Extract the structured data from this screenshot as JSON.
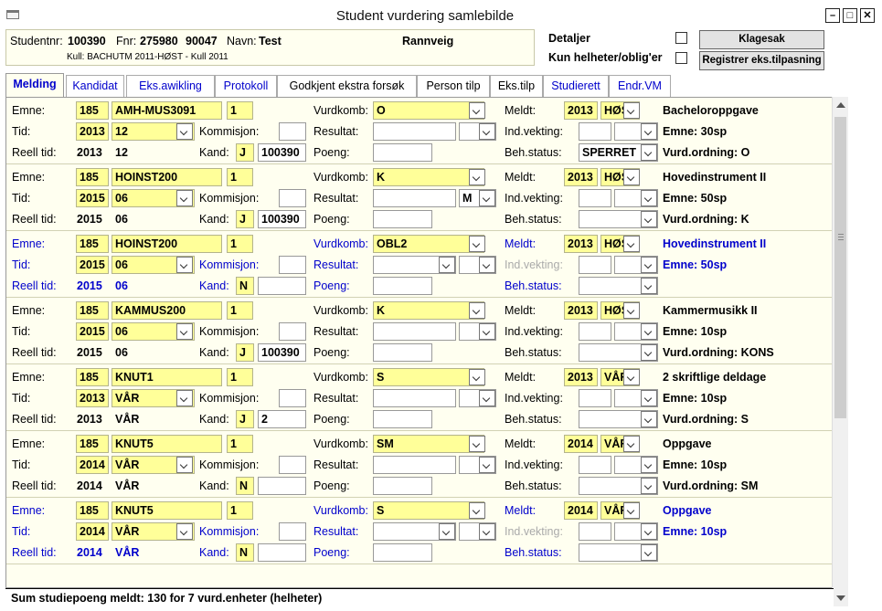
{
  "window": {
    "title": "Student vurdering samlebilde"
  },
  "header": {
    "studentnr_label": "Studentnr:",
    "studentnr": "100390",
    "fnr_label": "Fnr:",
    "fnr1": "275980",
    "fnr2": "90047",
    "navn_label": "Navn:",
    "fornavn": "Test",
    "etternavn": "Rannveig",
    "kull": "Kull: BACHUTM 2011-HØST - Kull 2011"
  },
  "options": {
    "detaljer": "Detaljer",
    "kun_helheter": "Kun helheter/oblig'er"
  },
  "buttons": {
    "klagesak": "Klagesak",
    "registrer": "Registrer eks.tilpasning"
  },
  "tabs": [
    "Melding",
    "Kandidat",
    "Eks.awikling",
    "Protokoll",
    "Godkjent ekstra forsøk",
    "Person tilp",
    "Eks.tilp",
    "Studierett",
    "Endr.VM"
  ],
  "labels": {
    "emne": "Emne:",
    "tid": "Tid:",
    "reell_tid": "Reell tid:",
    "kommisjon": "Kommisjon:",
    "kand": "Kand:",
    "vurdkomb": "Vurdkomb:",
    "resultat": "Resultat:",
    "poeng": "Poeng:",
    "meldt": "Meldt:",
    "ind_vekting": "Ind.vekting:",
    "beh_status": "Beh.status:"
  },
  "rows": [
    {
      "inst": "185",
      "emne": "AMH-MUS3091",
      "versjon": "1",
      "tid_aar": "2013",
      "tid_term": "12",
      "reell_aar": "2013",
      "reell_term": "12",
      "kand_flag": "J",
      "kand_nr": "100390",
      "vurdkomb": "O",
      "resultat_grade": "",
      "meldt_aar": "2013",
      "meldt_term": "HØST",
      "beh_status": "SPERRET",
      "emne_navn": "Bacheloroppgave",
      "emne_sp": "Emne: 30sp",
      "vurd_ordning": "Vurd.ordning: O",
      "blue": false
    },
    {
      "inst": "185",
      "emne": "HOINST200",
      "versjon": "1",
      "tid_aar": "2015",
      "tid_term": "06",
      "reell_aar": "2015",
      "reell_term": "06",
      "kand_flag": "J",
      "kand_nr": "100390",
      "vurdkomb": "K",
      "resultat_grade": "M",
      "meldt_aar": "2013",
      "meldt_term": "HØST",
      "beh_status": "",
      "emne_navn": "Hovedinstrument II",
      "emne_sp": "Emne: 50sp",
      "vurd_ordning": "Vurd.ordning: K",
      "blue": false
    },
    {
      "inst": "185",
      "emne": "HOINST200",
      "versjon": "1",
      "tid_aar": "2015",
      "tid_term": "06",
      "reell_aar": "2015",
      "reell_term": "06",
      "kand_flag": "N",
      "kand_nr": "",
      "vurdkomb": "OBL2",
      "resultat_grade": "",
      "meldt_aar": "2013",
      "meldt_term": "HØST",
      "beh_status": "",
      "emne_navn": "Hovedinstrument II",
      "emne_sp": "Emne: 50sp",
      "vurd_ordning": "",
      "blue": true
    },
    {
      "inst": "185",
      "emne": "KAMMUS200",
      "versjon": "1",
      "tid_aar": "2015",
      "tid_term": "06",
      "reell_aar": "2015",
      "reell_term": "06",
      "kand_flag": "J",
      "kand_nr": "100390",
      "vurdkomb": "K",
      "resultat_grade": "",
      "meldt_aar": "2013",
      "meldt_term": "HØST",
      "beh_status": "",
      "emne_navn": "Kammermusikk II",
      "emne_sp": "Emne: 10sp",
      "vurd_ordning": "Vurd.ordning: KONS",
      "blue": false
    },
    {
      "inst": "185",
      "emne": "KNUT1",
      "versjon": "1",
      "tid_aar": "2013",
      "tid_term": "VÅR",
      "reell_aar": "2013",
      "reell_term": "VÅR",
      "kand_flag": "J",
      "kand_nr": "2",
      "vurdkomb": "S",
      "resultat_grade": "",
      "meldt_aar": "2013",
      "meldt_term": "VÅR",
      "beh_status": "",
      "emne_navn": "2 skriftlige deldage",
      "emne_sp": "Emne: 10sp",
      "vurd_ordning": "Vurd.ordning: S",
      "blue": false
    },
    {
      "inst": "185",
      "emne": "KNUT5",
      "versjon": "1",
      "tid_aar": "2014",
      "tid_term": "VÅR",
      "reell_aar": "2014",
      "reell_term": "VÅR",
      "kand_flag": "N",
      "kand_nr": "",
      "vurdkomb": "SM",
      "resultat_grade": "",
      "meldt_aar": "2014",
      "meldt_term": "VÅR",
      "beh_status": "",
      "emne_navn": "Oppgave",
      "emne_sp": "Emne: 10sp",
      "vurd_ordning": "Vurd.ordning: SM",
      "blue": false
    },
    {
      "inst": "185",
      "emne": "KNUT5",
      "versjon": "1",
      "tid_aar": "2014",
      "tid_term": "VÅR",
      "reell_aar": "2014",
      "reell_term": "VÅR",
      "kand_flag": "N",
      "kand_nr": "",
      "vurdkomb": "S",
      "resultat_grade": "",
      "meldt_aar": "2014",
      "meldt_term": "VÅR",
      "beh_status": "",
      "emne_navn": "Oppgave",
      "emne_sp": "Emne: 10sp",
      "vurd_ordning": "",
      "blue": true
    }
  ],
  "footer": {
    "sum": "Sum studiepoeng meldt: 130 for 7 vurd.enheter (helheter)"
  }
}
